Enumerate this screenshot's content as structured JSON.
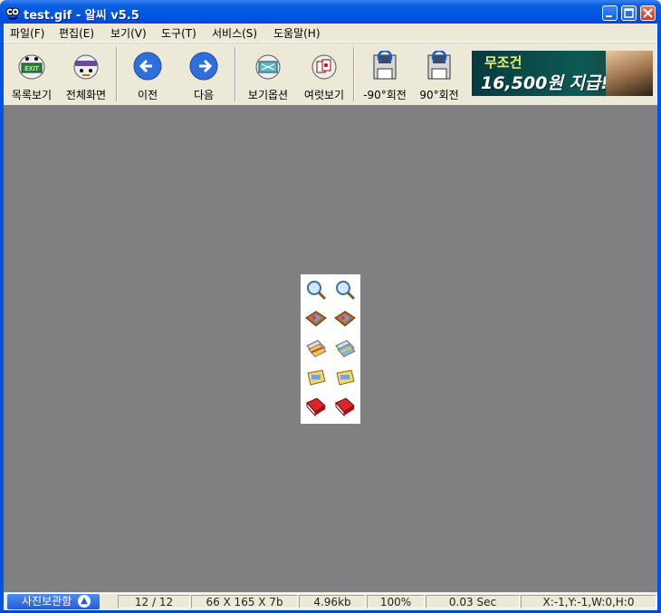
{
  "window": {
    "title": "test.gif - 알씨 v5.5"
  },
  "menu": [
    {
      "label": "파일(F)"
    },
    {
      "label": "편집(E)"
    },
    {
      "label": "보기(V)"
    },
    {
      "label": "도구(T)"
    },
    {
      "label": "서비스(S)"
    },
    {
      "label": "도움말(H)"
    }
  ],
  "toolbar": {
    "list_view": "목록보기",
    "fullscreen": "전체화면",
    "prev": "이전",
    "next": "다음",
    "view_options": "보기옵션",
    "multi_view": "여럿보기",
    "rotate_left": "-90°회전",
    "rotate_right": "90°회전"
  },
  "banner": {
    "line1": "무조건",
    "line2": "16,500원 지급!!"
  },
  "status": {
    "album_button": "사진보관함",
    "page": "12 / 12",
    "dimensions": "66 X 165 X 7b",
    "size": "4.96kb",
    "zoom": "100%",
    "time": "0.03 Sec",
    "coords": "X:-1,Y:-1,W:0,H:0"
  },
  "colors": {
    "viewer_bg": "#807f81",
    "titlebar": "#0054e3",
    "toolbar_bg": "#ece9d8"
  }
}
